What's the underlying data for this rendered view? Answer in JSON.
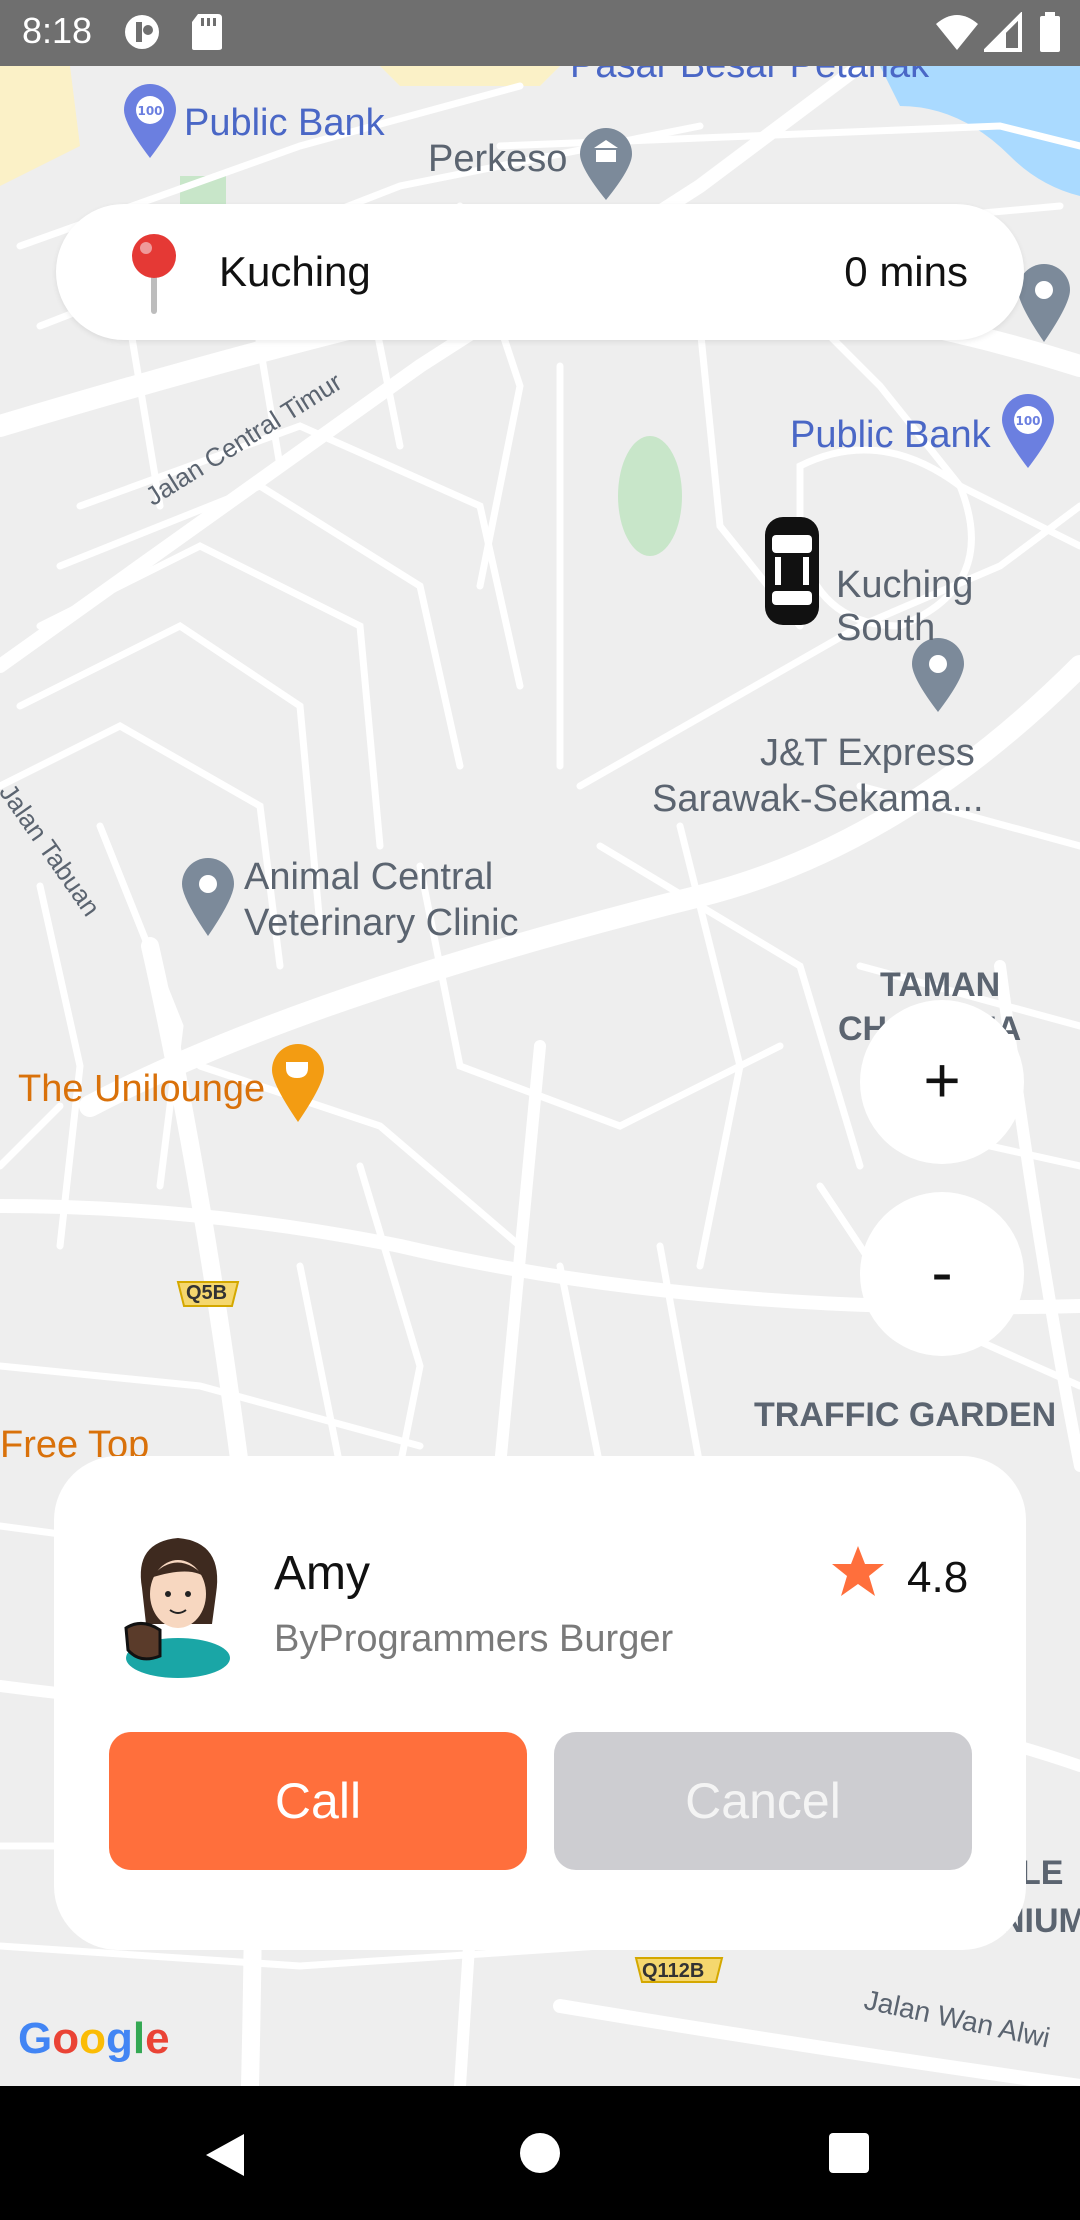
{
  "status_bar": {
    "time": "8:18"
  },
  "map": {
    "labels": {
      "pasar": "Pasar Besar Petanak",
      "public_bank_1": "Public Bank",
      "perkeso": "Perkeso",
      "public_bank_2": "Public Bank",
      "jalan_central_timur": "Jalan Central Timur",
      "kuching_south": "Kuching South",
      "jt_express_1": "J&T Express",
      "jt_express_2": "Sarawak-Sekama...",
      "jalan_tabuan": "Jalan Tabuan",
      "animal_central_1": "Animal Central",
      "animal_central_2": "Veterinary Clinic",
      "taman_1": "TAMAN",
      "taman_2": "CH         UA",
      "unilounge": "The Unilounge",
      "q5b": "Q5B",
      "traffic_garden": "TRAFFIC GARDEN",
      "free_top": "Free Top",
      "q112b": "Q112B",
      "jalan_wan_alwi": "Jalan Wan Alwi",
      "le": "LE",
      "nium": "NIUM",
      "google": "Google"
    },
    "zoom_in_label": "+",
    "zoom_out_label": "-"
  },
  "search_card": {
    "city": "Kuching",
    "eta": "0 mins"
  },
  "driver": {
    "name": "Amy",
    "shop": "ByProgrammers Burger",
    "rating": "4.8"
  },
  "actions": {
    "call_label": "Call",
    "cancel_label": "Cancel"
  },
  "colors": {
    "accent": "#ff6f3c",
    "cancel": "#cdcdd1",
    "status_bar": "#6f6f6f"
  }
}
